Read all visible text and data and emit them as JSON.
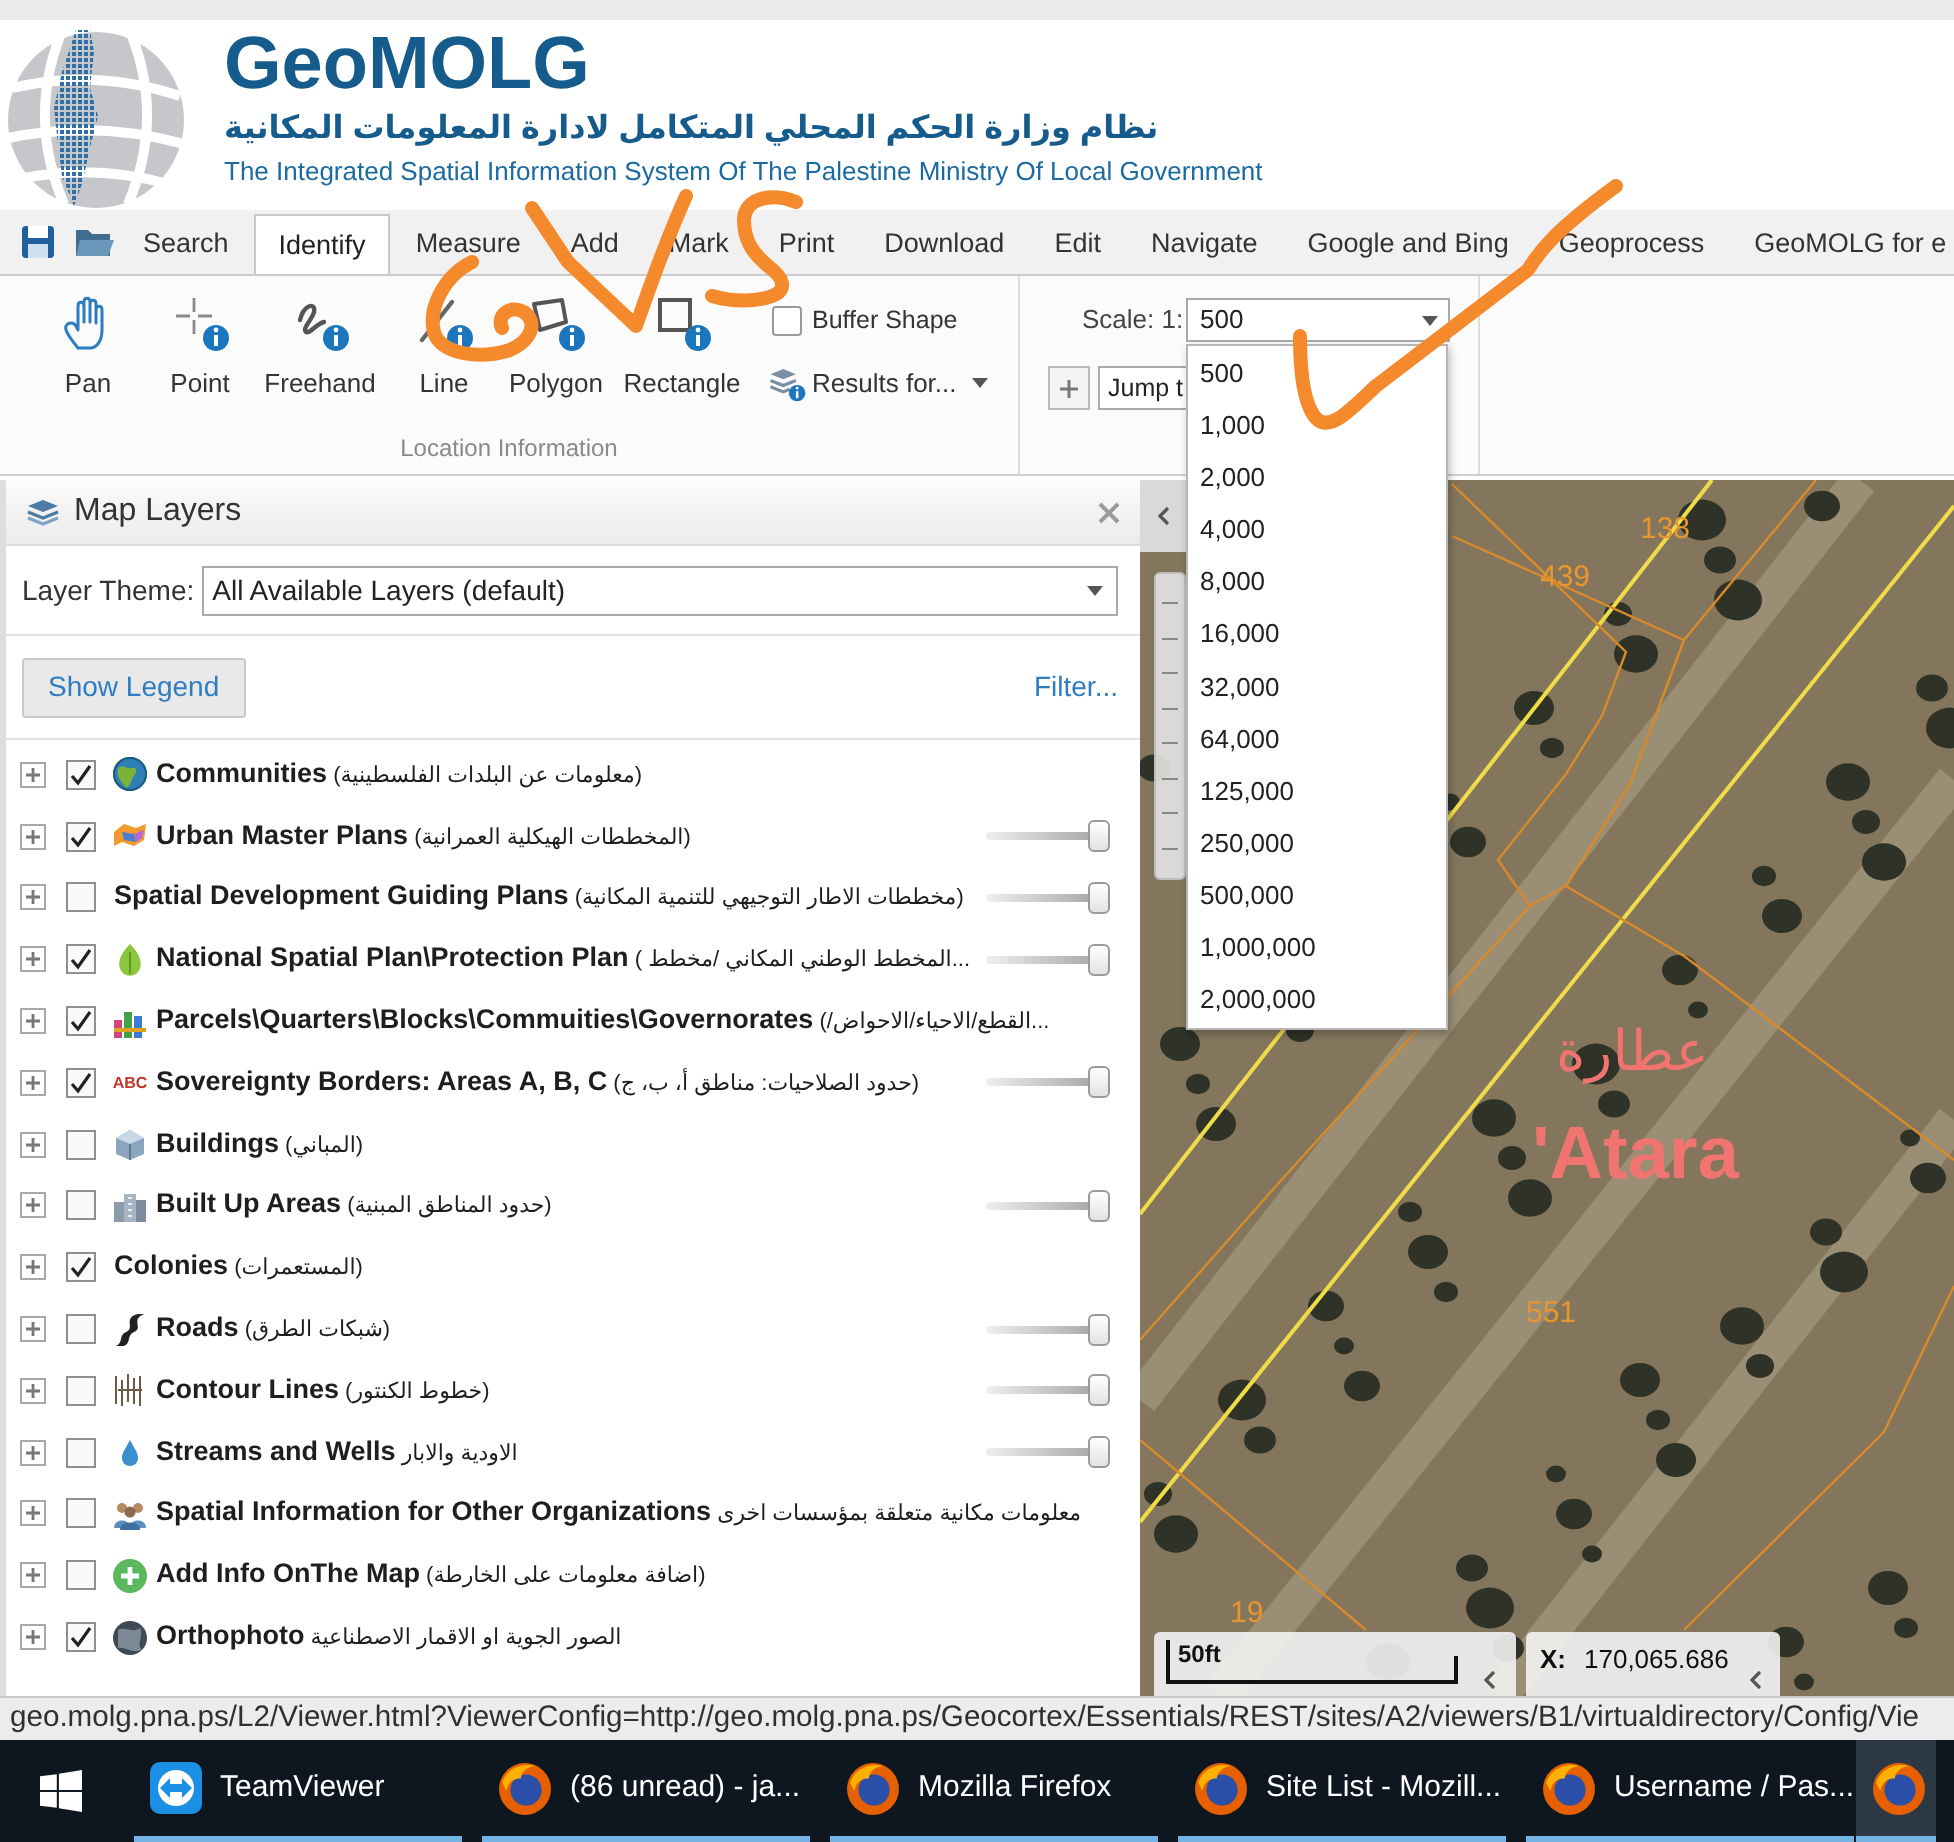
{
  "header": {
    "title": "GeoMOLG",
    "subtitle_ar": "نظام وزارة الحكم المحلي المتكامل لادارة المعلومات المكانية",
    "subtitle_en": "The Integrated Spatial Information System Of The Palestine Ministry Of Local Government"
  },
  "toolbar": {
    "tabs": [
      {
        "label": "Search",
        "selected": false
      },
      {
        "label": "Identify",
        "selected": true
      },
      {
        "label": "Measure",
        "selected": false
      },
      {
        "label": "Add",
        "selected": false
      },
      {
        "label": "Mark",
        "selected": false
      },
      {
        "label": "Print",
        "selected": false
      },
      {
        "label": "Download",
        "selected": false
      },
      {
        "label": "Edit",
        "selected": false
      },
      {
        "label": "Navigate",
        "selected": false
      },
      {
        "label": "Google and Bing",
        "selected": false
      },
      {
        "label": "Geoprocess",
        "selected": false
      },
      {
        "label": "GeoMOLG for e",
        "selected": false
      }
    ]
  },
  "ribbon": {
    "tools": [
      "Pan",
      "Point",
      "Freehand",
      "Line",
      "Polygon",
      "Rectangle"
    ],
    "buffer_shape": {
      "label": "Buffer Shape",
      "checked": false
    },
    "results_label": "Results for...",
    "group_label": "Location Information"
  },
  "scale": {
    "label": "Scale: 1:",
    "value": "500",
    "expanded": true,
    "options": [
      "500",
      "1,000",
      "2,000",
      "4,000",
      "8,000",
      "16,000",
      "32,000",
      "64,000",
      "125,000",
      "250,000",
      "500,000",
      "1,000,000",
      "2,000,000"
    ],
    "jump_label": "Jump t"
  },
  "map_layers": {
    "title": "Map Layers",
    "theme_label": "Layer Theme:",
    "theme_value": "All Available Layers (default)",
    "legend_button": "Show Legend",
    "filter_link": "Filter...",
    "layers": [
      {
        "label": "**Communities** (معلومات عن البلدات الفلسطينية)",
        "expanded": false,
        "checked": true
      },
      {
        "label": "**Urban Master Plans** (المخططات الهيكلية العمرانية)",
        "expanded": false,
        "checked": true,
        "slider": {
          "level": 1
        }
      },
      {
        "label": "**Spatial Development Guiding Plans** (مخططات الاطار التوجيهي للتنمية المكانية)",
        "expanded": false,
        "checked": false,
        "slider": {
          "level": 1
        }
      },
      {
        "label": "**National Spatial Plan\\Protection Plan** ( المخطط الوطني المكاني /مخطط...",
        "expanded": false,
        "checked": true,
        "slider": {
          "level": 1
        }
      },
      {
        "label": "**Parcels\\Quarters\\Blocks\\Commuities\\Governorates** (/القطع/الاحياء/الاحواض...",
        "expanded": false,
        "checked": true
      },
      {
        "label": "**Sovereignty Borders: Areas A, B, C** (حدود الصلاحيات: مناطق أ، ب، ج)",
        "expanded": false,
        "checked": true,
        "icon_text": "ABC",
        "slider": {
          "level": 1
        }
      },
      {
        "label": "**Buildings** (المباني)",
        "expanded": false,
        "checked": false
      },
      {
        "label": "**Built Up Areas** (حدود المناطق المبنية)",
        "expanded": false,
        "checked": false,
        "slider": {
          "level": 1
        }
      },
      {
        "label": "**Colonies** (المستعمرات)",
        "expanded": false,
        "checked": true
      },
      {
        "label": "**Roads** (شبكات الطرق)",
        "expanded": false,
        "checked": false,
        "slider": {
          "level": 1
        }
      },
      {
        "label": "**Contour Lines** (خطوط الكنتور)",
        "expanded": false,
        "checked": false,
        "slider": {
          "level": 1
        }
      },
      {
        "label": "**Streams and Wells** الاودية والابار",
        "expanded": false,
        "checked": false,
        "slider": {
          "level": 1
        }
      },
      {
        "label": "**Spatial Information for Other Organizations** معلومات مكانية متعلقة بمؤسسات اخرى",
        "expanded": false,
        "checked": false
      },
      {
        "label": "**Add Info OnThe Map** (اضافة معلومات على الخارطة)",
        "expanded": false,
        "checked": false
      },
      {
        "label": "**Orthophoto** الصور الجوية او الاقمار الاصطناعية",
        "expanded": false,
        "checked": true
      }
    ]
  },
  "map": {
    "labels": [
      {
        "kind": "parcel",
        "text": "138"
      },
      {
        "kind": "parcel",
        "text": "439"
      },
      {
        "kind": "place",
        "text": "عطارة"
      },
      {
        "kind": "place",
        "text": "'Atara"
      },
      {
        "kind": "parcel",
        "text": "551"
      },
      {
        "kind": "parcel",
        "text": "19"
      }
    ],
    "scale_bar": "50ft",
    "coordinates": {
      "label": "X:",
      "value": "170,065.686"
    }
  },
  "status_bar": {
    "url": "geo.molg.pna.ps/L2/Viewer.html?ViewerConfig=http://geo.molg.pna.ps/Geocortex/Essentials/REST/sites/A2/viewers/B1/virtualdirectory/Config/Vie"
  },
  "taskbar": {
    "items": [
      {
        "label": "TeamViewer",
        "selected": false
      },
      {
        "label": "(86 unread) - ja...",
        "selected": false
      },
      {
        "label": "Mozilla Firefox",
        "selected": false
      },
      {
        "label": "Site List - Mozill...",
        "selected": false
      },
      {
        "label": "Username / Pas...",
        "selected": false
      },
      {
        "selected": true
      }
    ]
  }
}
